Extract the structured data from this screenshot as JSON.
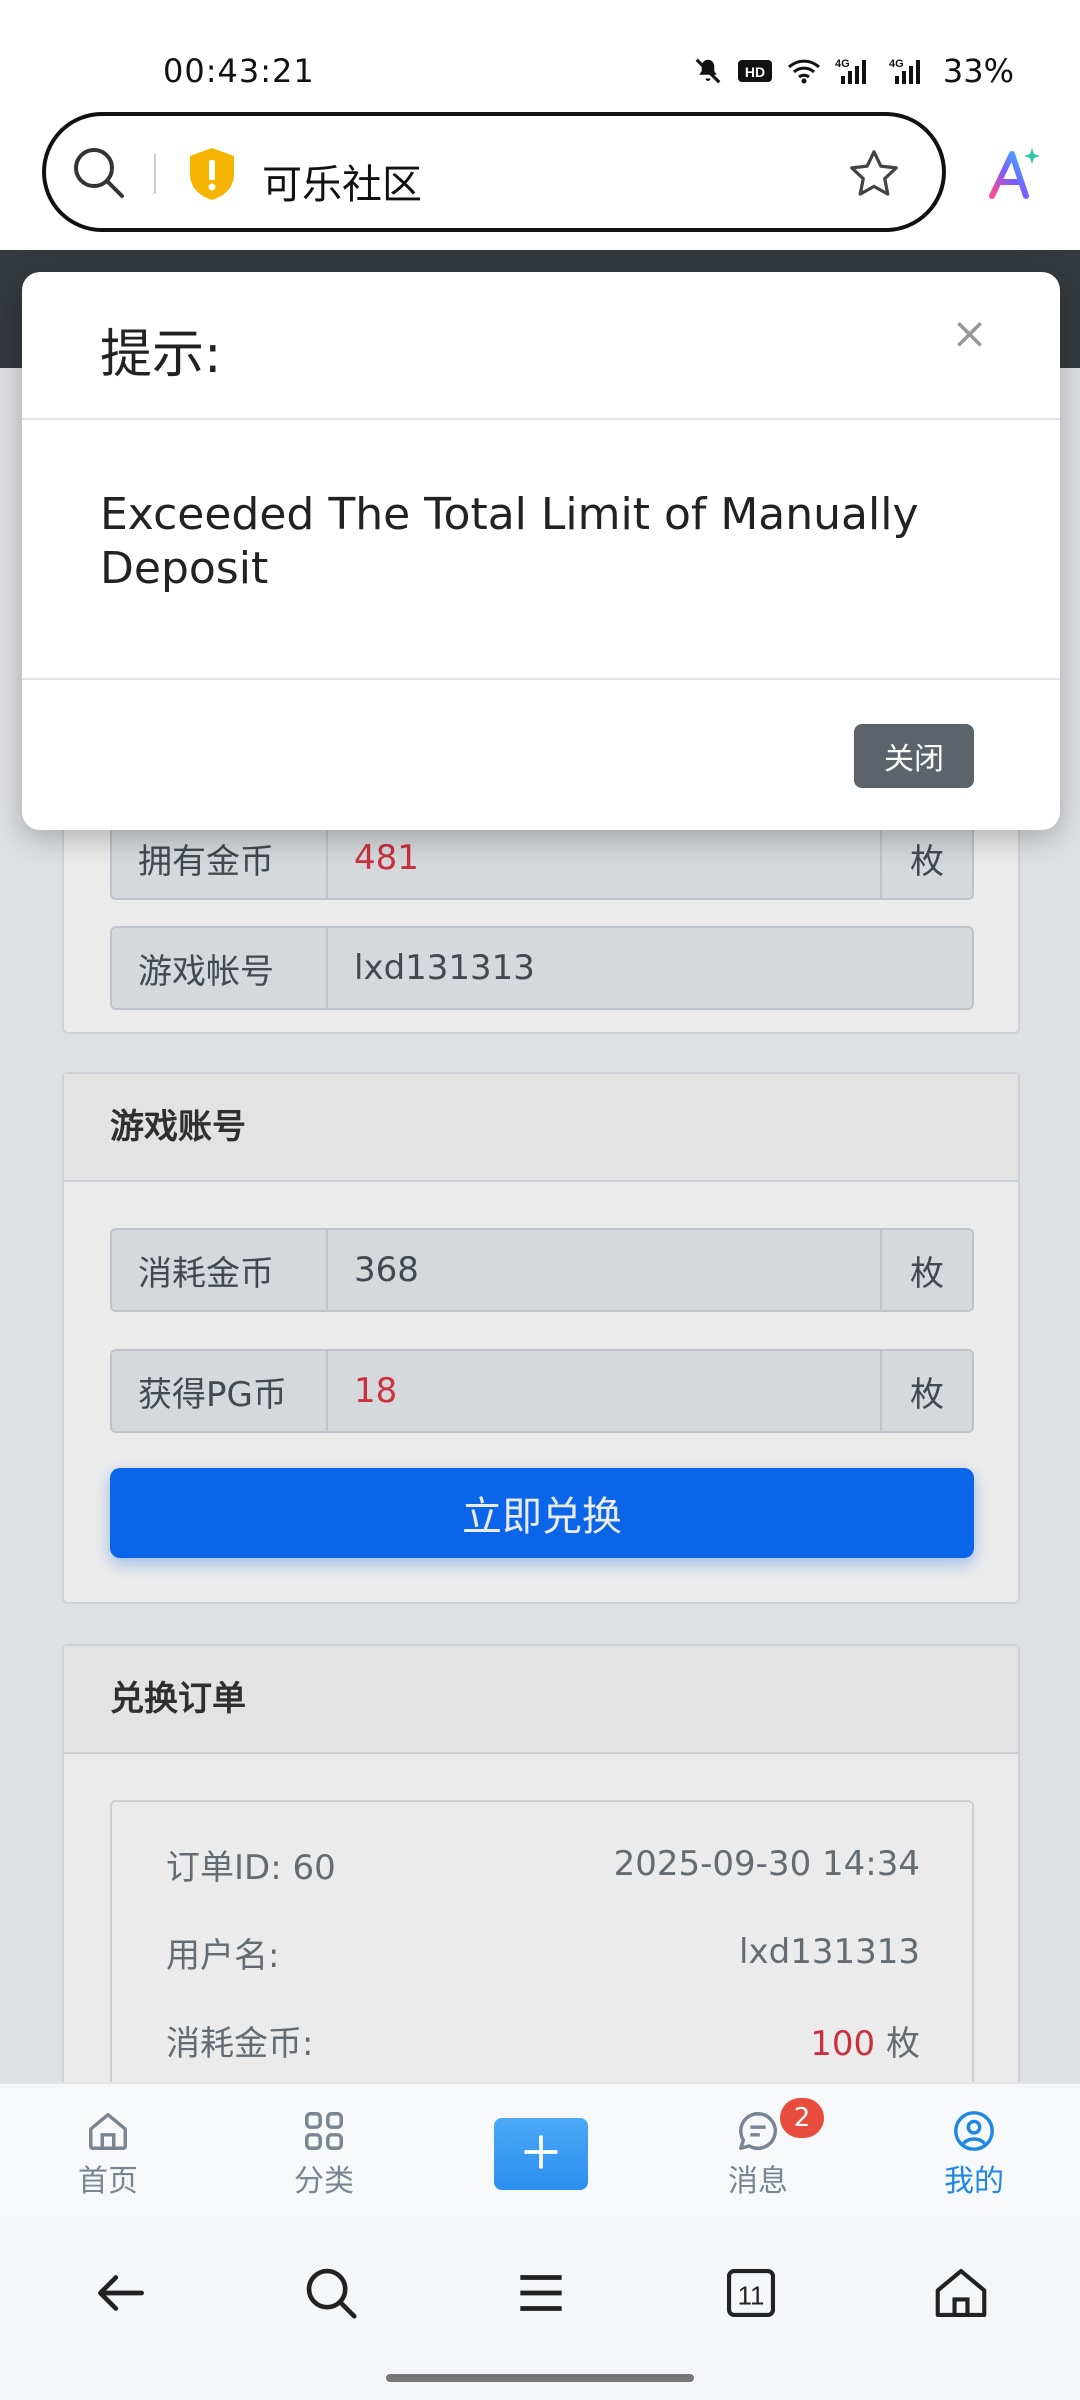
{
  "status": {
    "time": "00:43:21",
    "battery": "33%",
    "network1": "4G",
    "network2": "4G"
  },
  "browser": {
    "site_name": "可乐社区"
  },
  "card1": {
    "owned_label": "拥有金币",
    "owned_value": "481",
    "owned_unit": "枚",
    "account_label": "游戏帐号",
    "account_value": "lxd131313"
  },
  "card2": {
    "title": "游戏账号",
    "cost_label": "消耗金币",
    "cost_value": "368",
    "cost_unit": "枚",
    "gain_label": "获得PG币",
    "gain_value": "18",
    "gain_unit": "枚",
    "submit_label": "立即兑换"
  },
  "orders": {
    "title": "兑换订单",
    "order_id_label": "订单ID:",
    "order_id": "60",
    "datetime": "2025-09-30 14:34",
    "username_label": "用户名:",
    "username": "lxd131313",
    "cost_label": "消耗金币:",
    "cost_value": "100",
    "cost_unit": "枚"
  },
  "modal": {
    "title": "提示:",
    "close_glyph": "×",
    "message": "Exceeded The Total Limit of Manually Deposit",
    "close_button": "关闭"
  },
  "tabbar": {
    "items": [
      {
        "label": "首页",
        "icon": "home-icon"
      },
      {
        "label": "分类",
        "icon": "grid-icon"
      },
      {
        "label": "消息",
        "icon": "message-icon"
      },
      {
        "label": "我的",
        "icon": "user-icon"
      }
    ],
    "message_badge": "2",
    "active_color": "#1e88e5"
  },
  "navbar": {
    "tabs_count": "11"
  },
  "colors": {
    "primary": "#0d6efd",
    "danger": "#dc3545",
    "secondary": "#5c636a"
  }
}
